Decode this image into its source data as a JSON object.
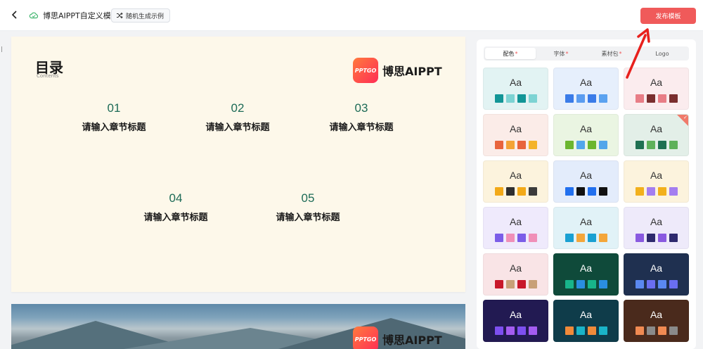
{
  "header": {
    "title": "博思AIPPT自定义模板",
    "random_label": "随机生成示例",
    "publish_label": "发布模板"
  },
  "slide": {
    "heading": "目录",
    "subheading": "Contents",
    "logo_badge": "PPTGO",
    "logo_text": "博思AIPPT",
    "chapters": [
      {
        "num": "01",
        "title": "请输入章节标题"
      },
      {
        "num": "02",
        "title": "请输入章节标题"
      },
      {
        "num": "03",
        "title": "请输入章节标题"
      },
      {
        "num": "04",
        "title": "请输入章节标题"
      },
      {
        "num": "05",
        "title": "请输入章节标题"
      }
    ]
  },
  "slide2": {
    "logo_badge": "PPTGO",
    "logo_text": "博思AIPPT"
  },
  "panel": {
    "tabs": [
      {
        "label": "配色",
        "star": "*",
        "active": true
      },
      {
        "label": "字体",
        "star": "*",
        "active": false
      },
      {
        "label": "素材包",
        "star": "*",
        "active": false
      },
      {
        "label": "Logo",
        "star": "",
        "active": false
      }
    ],
    "swatches": [
      {
        "label": "Aa",
        "bg": "#e2f3f3",
        "text": "#333333",
        "colors": [
          "#129596",
          "#7dd3d3",
          "#129596",
          "#7dd3d3"
        ]
      },
      {
        "label": "Aa",
        "bg": "#e6effc",
        "text": "#333333",
        "colors": [
          "#3a7be8",
          "#5a9cf0",
          "#3a7be8",
          "#5aa2f0"
        ]
      },
      {
        "label": "Aa",
        "bg": "#fbecee",
        "text": "#333333",
        "colors": [
          "#e87d86",
          "#7a2e2e",
          "#e87d86",
          "#7a2e2e"
        ]
      },
      {
        "label": "Aa",
        "bg": "#fbece8",
        "text": "#333333",
        "colors": [
          "#e8643c",
          "#f4a336",
          "#e8643c",
          "#f4b32a"
        ]
      },
      {
        "label": "Aa",
        "bg": "#eaf5e2",
        "text": "#333333",
        "colors": [
          "#6bb62e",
          "#52a6ea",
          "#6bb62e",
          "#52a6ea"
        ]
      },
      {
        "label": "Aa",
        "bg": "#e3efe8",
        "text": "#333333",
        "colors": [
          "#1f7052",
          "#5fb15a",
          "#1f7052",
          "#5fb15a"
        ],
        "selected": true
      },
      {
        "label": "Aa",
        "bg": "#fcf3dd",
        "text": "#333333",
        "colors": [
          "#f2a918",
          "#2f2f2f",
          "#f2a918",
          "#3b3b3b"
        ]
      },
      {
        "label": "Aa",
        "bg": "#e3ecfb",
        "text": "#333333",
        "colors": [
          "#2270ee",
          "#111111",
          "#2270ee",
          "#111111"
        ]
      },
      {
        "label": "Aa",
        "bg": "#fcf3dd",
        "text": "#333333",
        "colors": [
          "#f2b01c",
          "#a47ef0",
          "#f2b01c",
          "#a47ef0"
        ]
      },
      {
        "label": "Aa",
        "bg": "#efeafc",
        "text": "#333333",
        "colors": [
          "#7b5de8",
          "#f08fb8",
          "#7b5de8",
          "#f08fb8"
        ]
      },
      {
        "label": "Aa",
        "bg": "#e1f2f7",
        "text": "#333333",
        "colors": [
          "#1aa0d2",
          "#f4a63a",
          "#1aa0d2",
          "#f4a63a"
        ]
      },
      {
        "label": "Aa",
        "bg": "#eeeafa",
        "text": "#333333",
        "colors": [
          "#8a5ae0",
          "#2e2a6e",
          "#8a5ae0",
          "#2e2a6e"
        ]
      },
      {
        "label": "Aa",
        "bg": "#f9e4e6",
        "text": "#333333",
        "colors": [
          "#c8182a",
          "#c8a077",
          "#c8182a",
          "#c8a077"
        ]
      },
      {
        "label": "Aa",
        "bg": "#0f4a3a",
        "text": "#ffffff",
        "colors": [
          "#18b48a",
          "#2a8ee0",
          "#18b48a",
          "#2a8ee0"
        ]
      },
      {
        "label": "Aa",
        "bg": "#1f3050",
        "text": "#ffffff",
        "colors": [
          "#5a88f0",
          "#6a6ef0",
          "#5a88f0",
          "#6a6ef0"
        ]
      },
      {
        "label": "Aa",
        "bg": "#221a52",
        "text": "#ffffff",
        "colors": [
          "#7d4ff0",
          "#a45cf0",
          "#7d4ff0",
          "#a45cf0"
        ]
      },
      {
        "label": "Aa",
        "bg": "#0f3c4a",
        "text": "#ffffff",
        "colors": [
          "#f08a3a",
          "#1ab4c8",
          "#f08a3a",
          "#1ab4c8"
        ]
      },
      {
        "label": "Aa",
        "bg": "#4a2a1c",
        "text": "#ffffff",
        "colors": [
          "#f08a52",
          "#8a8a8a",
          "#f08a52",
          "#8a8a8a"
        ]
      }
    ]
  },
  "accent_color": "#f05a5a"
}
